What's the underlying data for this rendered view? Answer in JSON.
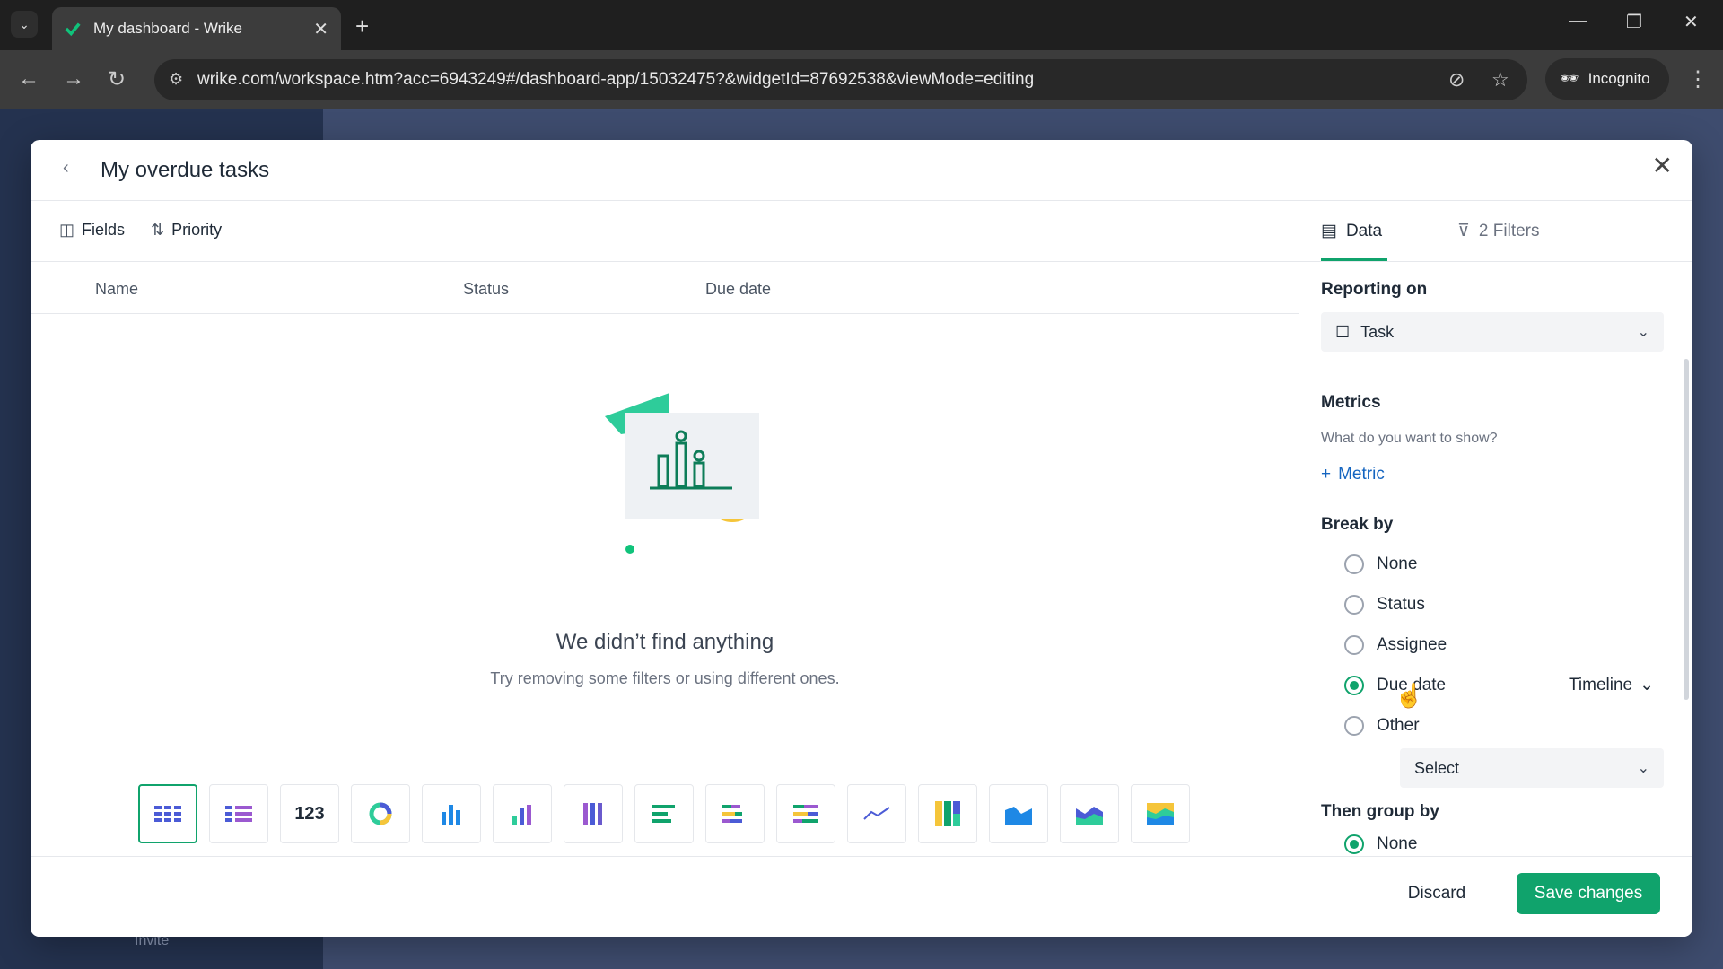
{
  "browser": {
    "tab_title": "My dashboard - Wrike",
    "url": "wrike.com/workspace.htm?acc=6943249#/dashboard-app/15032475?&widgetId=87692538&viewMode=editing",
    "incognito_label": "Incognito"
  },
  "app": {
    "invite_label": "Invite"
  },
  "modal": {
    "title": "My overdue tasks",
    "toolbar": {
      "fields_label": "Fields",
      "sort_label": "Priority"
    },
    "columns": [
      "Name",
      "Status",
      "Due date"
    ],
    "empty": {
      "title": "We didn’t find anything",
      "subtitle": "Try removing some filters or using different ones."
    },
    "chart_types": [
      {
        "icon": "table-icon",
        "selected": true
      },
      {
        "icon": "grouped-table-icon",
        "selected": false
      },
      {
        "icon": "number-icon",
        "label": "123",
        "selected": false
      },
      {
        "icon": "donut-chart-icon",
        "selected": false
      },
      {
        "icon": "column-chart-icon",
        "selected": false
      },
      {
        "icon": "stacked-column-chart-icon",
        "selected": false
      },
      {
        "icon": "full-stacked-column-icon",
        "selected": false
      },
      {
        "icon": "bar-chart-icon",
        "selected": false
      },
      {
        "icon": "stacked-bar-chart-icon",
        "selected": false
      },
      {
        "icon": "full-stacked-bar-icon",
        "selected": false
      },
      {
        "icon": "line-chart-icon",
        "selected": false
      },
      {
        "icon": "heatmap-icon",
        "selected": false
      },
      {
        "icon": "area-chart-icon",
        "selected": false
      },
      {
        "icon": "stacked-area-chart-icon",
        "selected": false
      },
      {
        "icon": "full-stacked-area-icon",
        "selected": false
      }
    ],
    "right": {
      "tab_data": "Data",
      "tab_filters": "2 Filters",
      "reporting_on_title": "Reporting on",
      "reporting_on_value": "Task",
      "metrics_title": "Metrics",
      "metrics_hint": "What do you want to show?",
      "add_metric_label": "Metric",
      "break_by_title": "Break by",
      "break_by_options": [
        {
          "label": "None",
          "checked": false
        },
        {
          "label": "Status",
          "checked": false
        },
        {
          "label": "Assignee",
          "checked": false
        },
        {
          "label": "Due date",
          "checked": true
        },
        {
          "label": "Other",
          "checked": false
        }
      ],
      "timeline_label": "Timeline",
      "other_select_placeholder": "Select",
      "group_by_title": "Then group by",
      "group_by_option": {
        "label": "None",
        "checked": true
      }
    },
    "footer": {
      "discard_label": "Discard",
      "save_label": "Save changes"
    }
  },
  "colors": {
    "accent": "#10a36c",
    "link": "#1565c0"
  }
}
